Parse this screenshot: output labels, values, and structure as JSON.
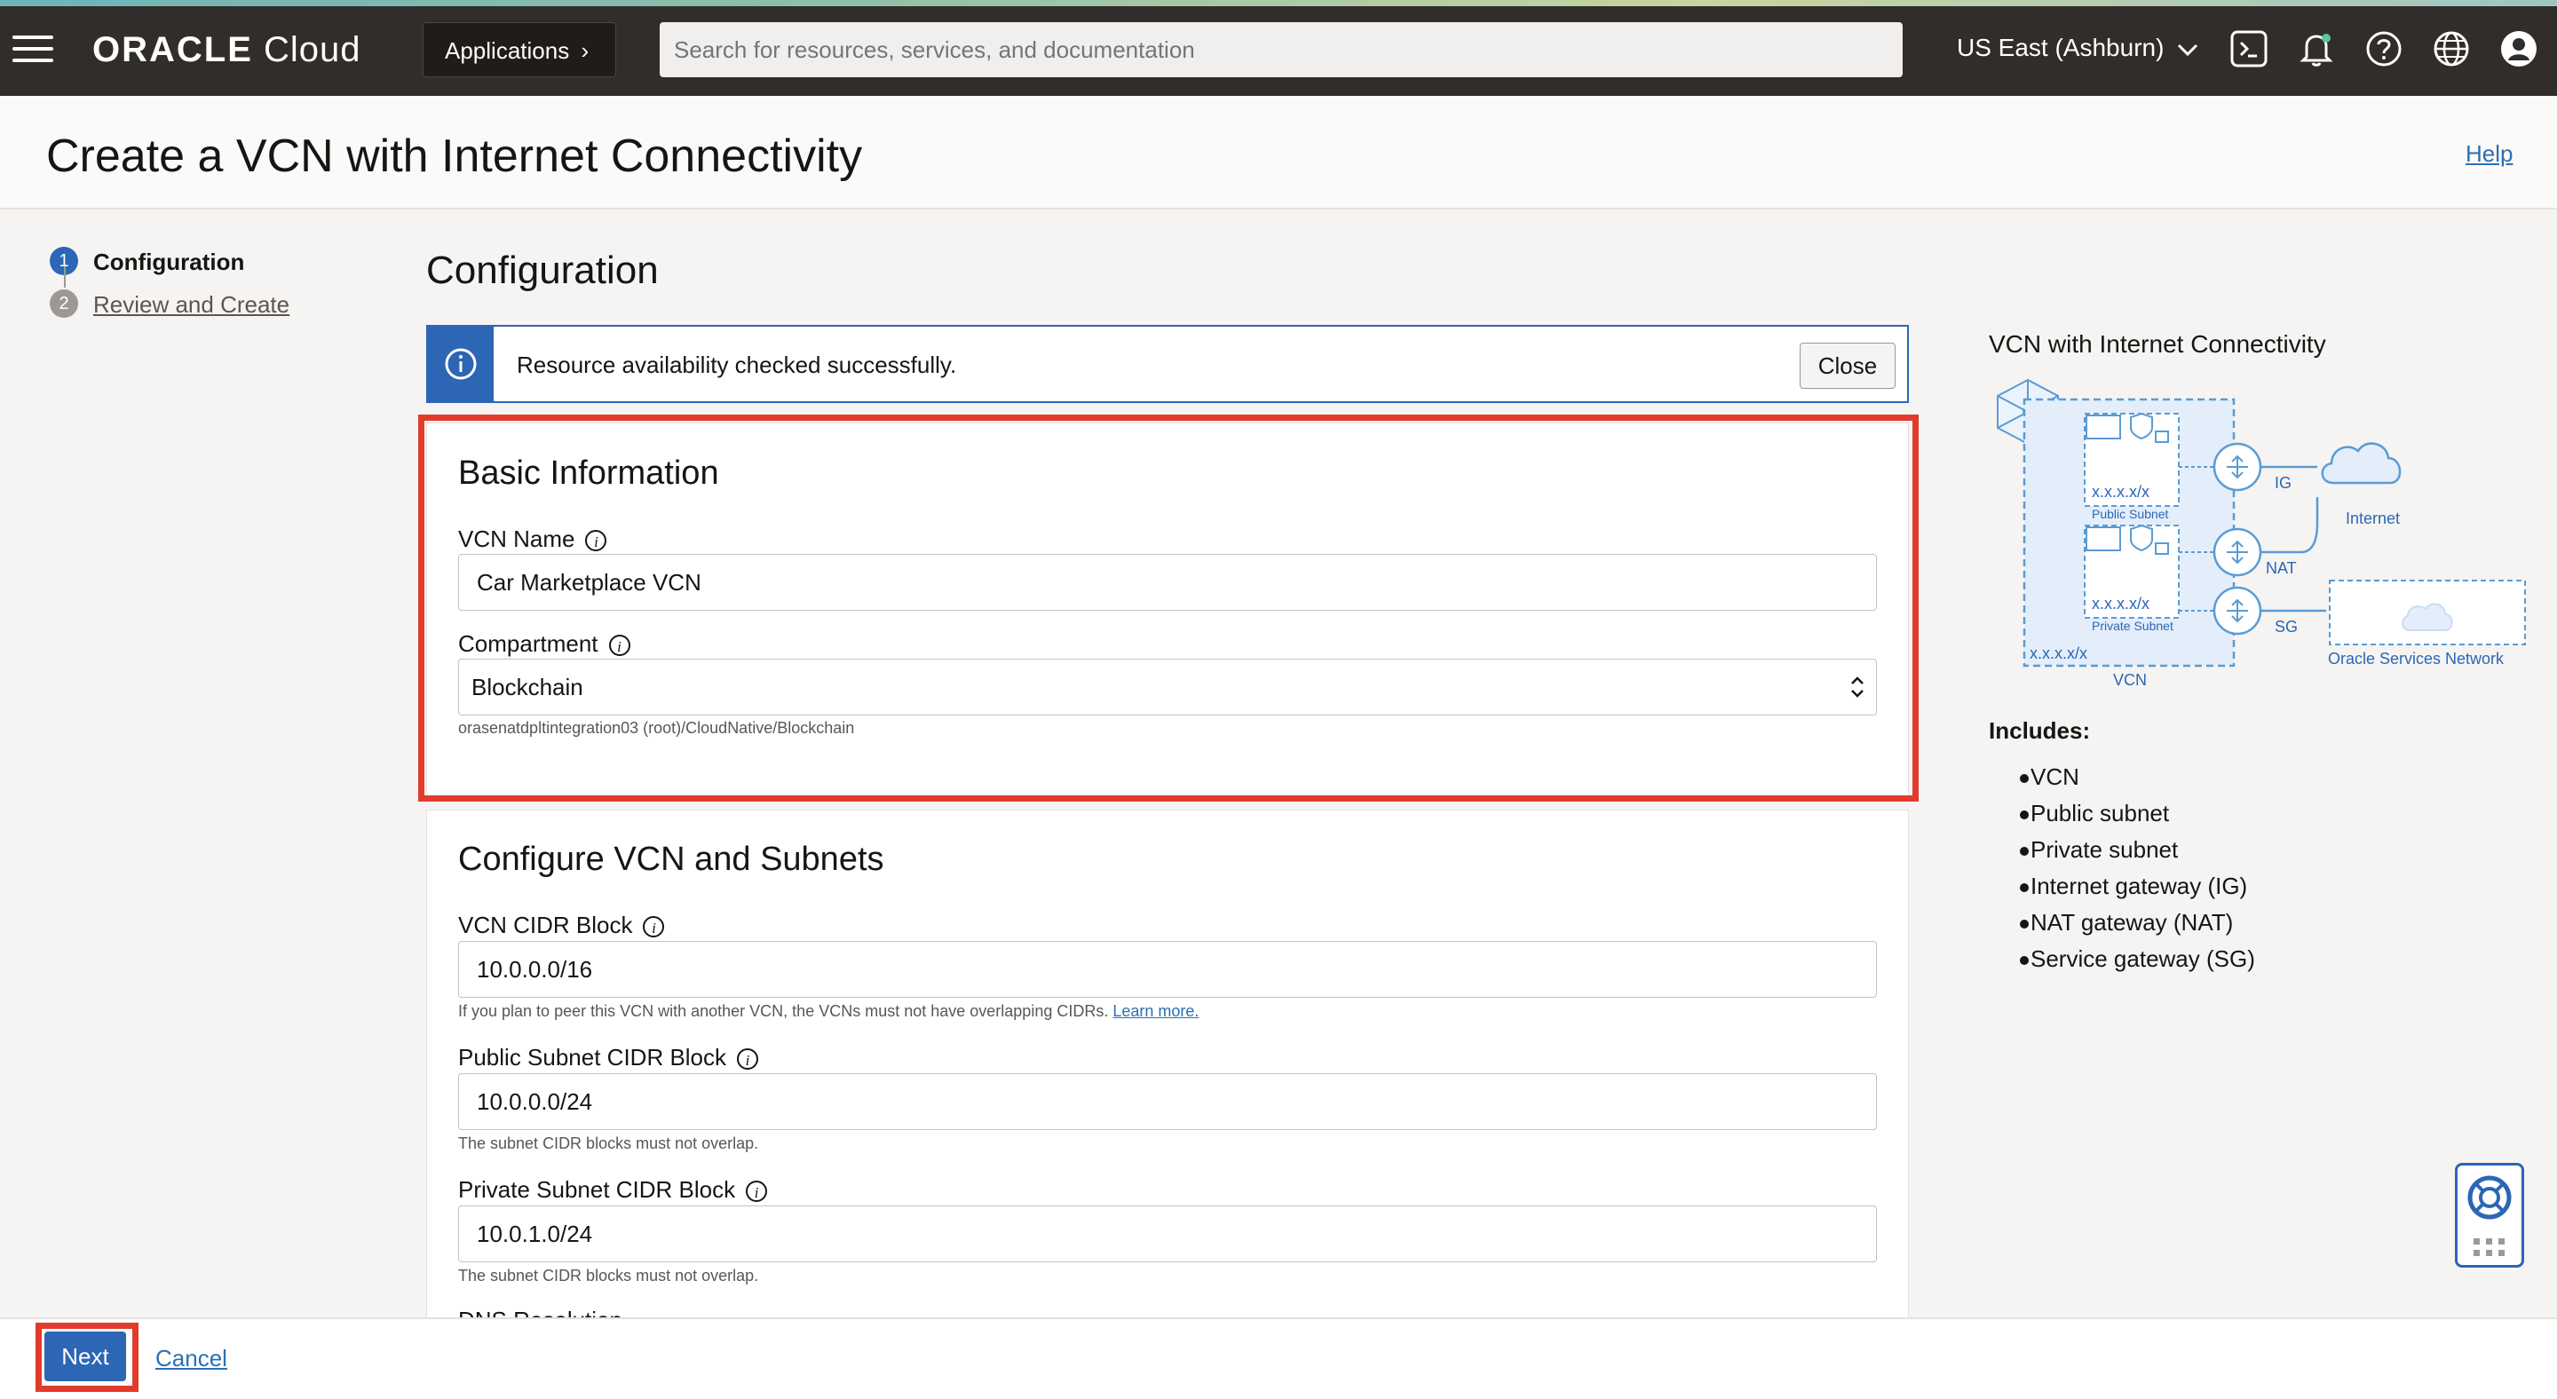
{
  "header": {
    "brand_oracle": "ORACLE",
    "brand_cloud": "Cloud",
    "applications_label": "Applications",
    "search_placeholder": "Search for resources, services, and documentation",
    "region": "US East (Ashburn)"
  },
  "page": {
    "title": "Create a VCN with Internet Connectivity",
    "help_link": "Help"
  },
  "steps": [
    {
      "number": "1",
      "label": "Configuration",
      "active": true
    },
    {
      "number": "2",
      "label": "Review and Create",
      "active": false
    }
  ],
  "section_title": "Configuration",
  "info_banner": {
    "message": "Resource availability checked successfully.",
    "close_label": "Close"
  },
  "basic_information": {
    "title": "Basic Information",
    "vcn_name_label": "VCN Name",
    "vcn_name_value": "Car Marketplace VCN",
    "compartment_label": "Compartment",
    "compartment_value": "Blockchain",
    "compartment_path": "orasenatdpltintegration03 (root)/CloudNative/Blockchain"
  },
  "configure_vcn": {
    "title": "Configure VCN and Subnets",
    "vcn_cidr_label": "VCN CIDR Block",
    "vcn_cidr_value": "10.0.0.0/16",
    "vcn_cidr_hint": "If you plan to peer this VCN with another VCN, the VCNs must not have overlapping CIDRs.",
    "learn_more": "Learn more.",
    "public_cidr_label": "Public Subnet CIDR Block",
    "public_cidr_value": "10.0.0.0/24",
    "public_cidr_hint": "The subnet CIDR blocks must not overlap.",
    "private_cidr_label": "Private Subnet CIDR Block",
    "private_cidr_value": "10.0.1.0/24",
    "private_cidr_hint": "The subnet CIDR blocks must not overlap.",
    "dns_label_partial": "DNS Resolution"
  },
  "diagram": {
    "title": "VCN with Internet Connectivity",
    "public_subnet": "Public Subnet",
    "private_subnet": "Private Subnet",
    "cidr_placeholder": "x.x.x.x/x",
    "vcn": "VCN",
    "ig": "IG",
    "nat": "NAT",
    "sg": "SG",
    "internet": "Internet",
    "osn": "Oracle Services Network"
  },
  "includes": {
    "title": "Includes:",
    "items": [
      "VCN",
      "Public subnet",
      "Private subnet",
      "Internet gateway (IG)",
      "NAT gateway (NAT)",
      "Service gateway (SG)"
    ]
  },
  "footer": {
    "next_label": "Next",
    "cancel_label": "Cancel"
  },
  "colors": {
    "topbar": "#312d2a",
    "accent_blue": "#2c66b5",
    "highlight_red": "#e03b2b",
    "link": "#2b6fb5"
  }
}
